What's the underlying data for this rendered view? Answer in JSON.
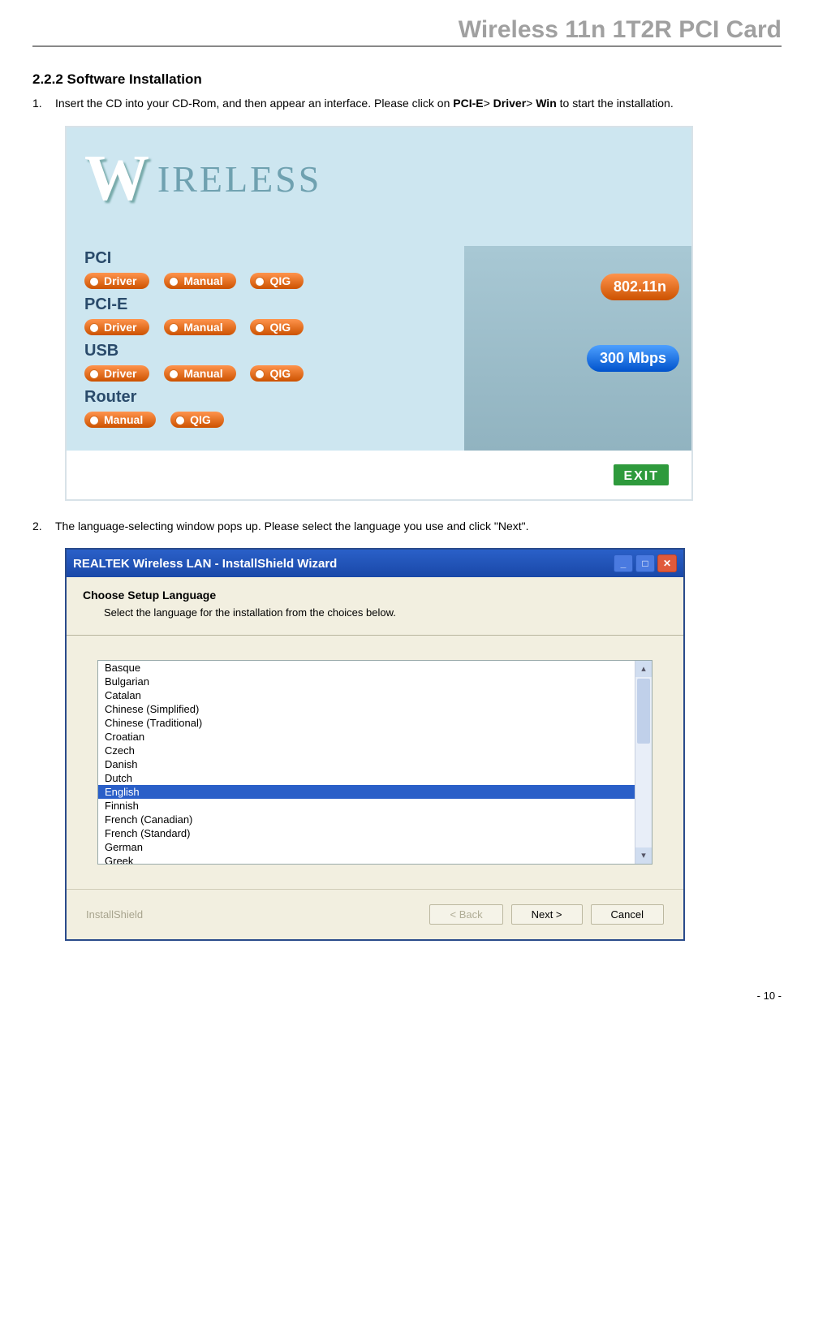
{
  "document": {
    "header_title": "Wireless 11n 1T2R PCI Card",
    "section_heading": "2.2.2 Software Installation",
    "step1_num": "1.",
    "step1_text_pre": "Insert the CD into your CD-Rom, and then appear an interface. Please click on ",
    "step1_bold1": "PCI-E",
    "step1_gt1": "> ",
    "step1_bold2": "Driver",
    "step1_gt2": "> ",
    "step1_bold3": "Win",
    "step1_text_post": " to start the installation.",
    "step2_num": "2.",
    "step2_text": "The language-selecting window pops up. Please select the language you use and click \"Next\".",
    "page_number": "- 10 -"
  },
  "screenshot1": {
    "brand_W": "W",
    "brand_rest": "IRELESS",
    "categories": [
      {
        "name": "PCI",
        "buttons": [
          "Driver",
          "Manual",
          "QIG"
        ]
      },
      {
        "name": "PCI-E",
        "buttons": [
          "Driver",
          "Manual",
          "QIG"
        ]
      },
      {
        "name": "USB",
        "buttons": [
          "Driver",
          "Manual",
          "QIG"
        ]
      },
      {
        "name": "Router",
        "buttons": [
          "Manual",
          "QIG"
        ]
      }
    ],
    "badge_80211n": "802.11n",
    "badge_300m": "300 Mbps",
    "exit_label": "EXIT"
  },
  "dialog": {
    "title": "REALTEK Wireless LAN   - InstallShield Wizard",
    "heading": "Choose Setup Language",
    "subheading": "Select the language for the installation from the choices below.",
    "languages": [
      "Basque",
      "Bulgarian",
      "Catalan",
      "Chinese (Simplified)",
      "Chinese (Traditional)",
      "Croatian",
      "Czech",
      "Danish",
      "Dutch",
      "English",
      "Finnish",
      "French (Canadian)",
      "French (Standard)",
      "German",
      "Greek"
    ],
    "selected_language": "English",
    "installshield_label": "InstallShield",
    "back_label": "< Back",
    "next_label": "Next >",
    "cancel_label": "Cancel"
  }
}
